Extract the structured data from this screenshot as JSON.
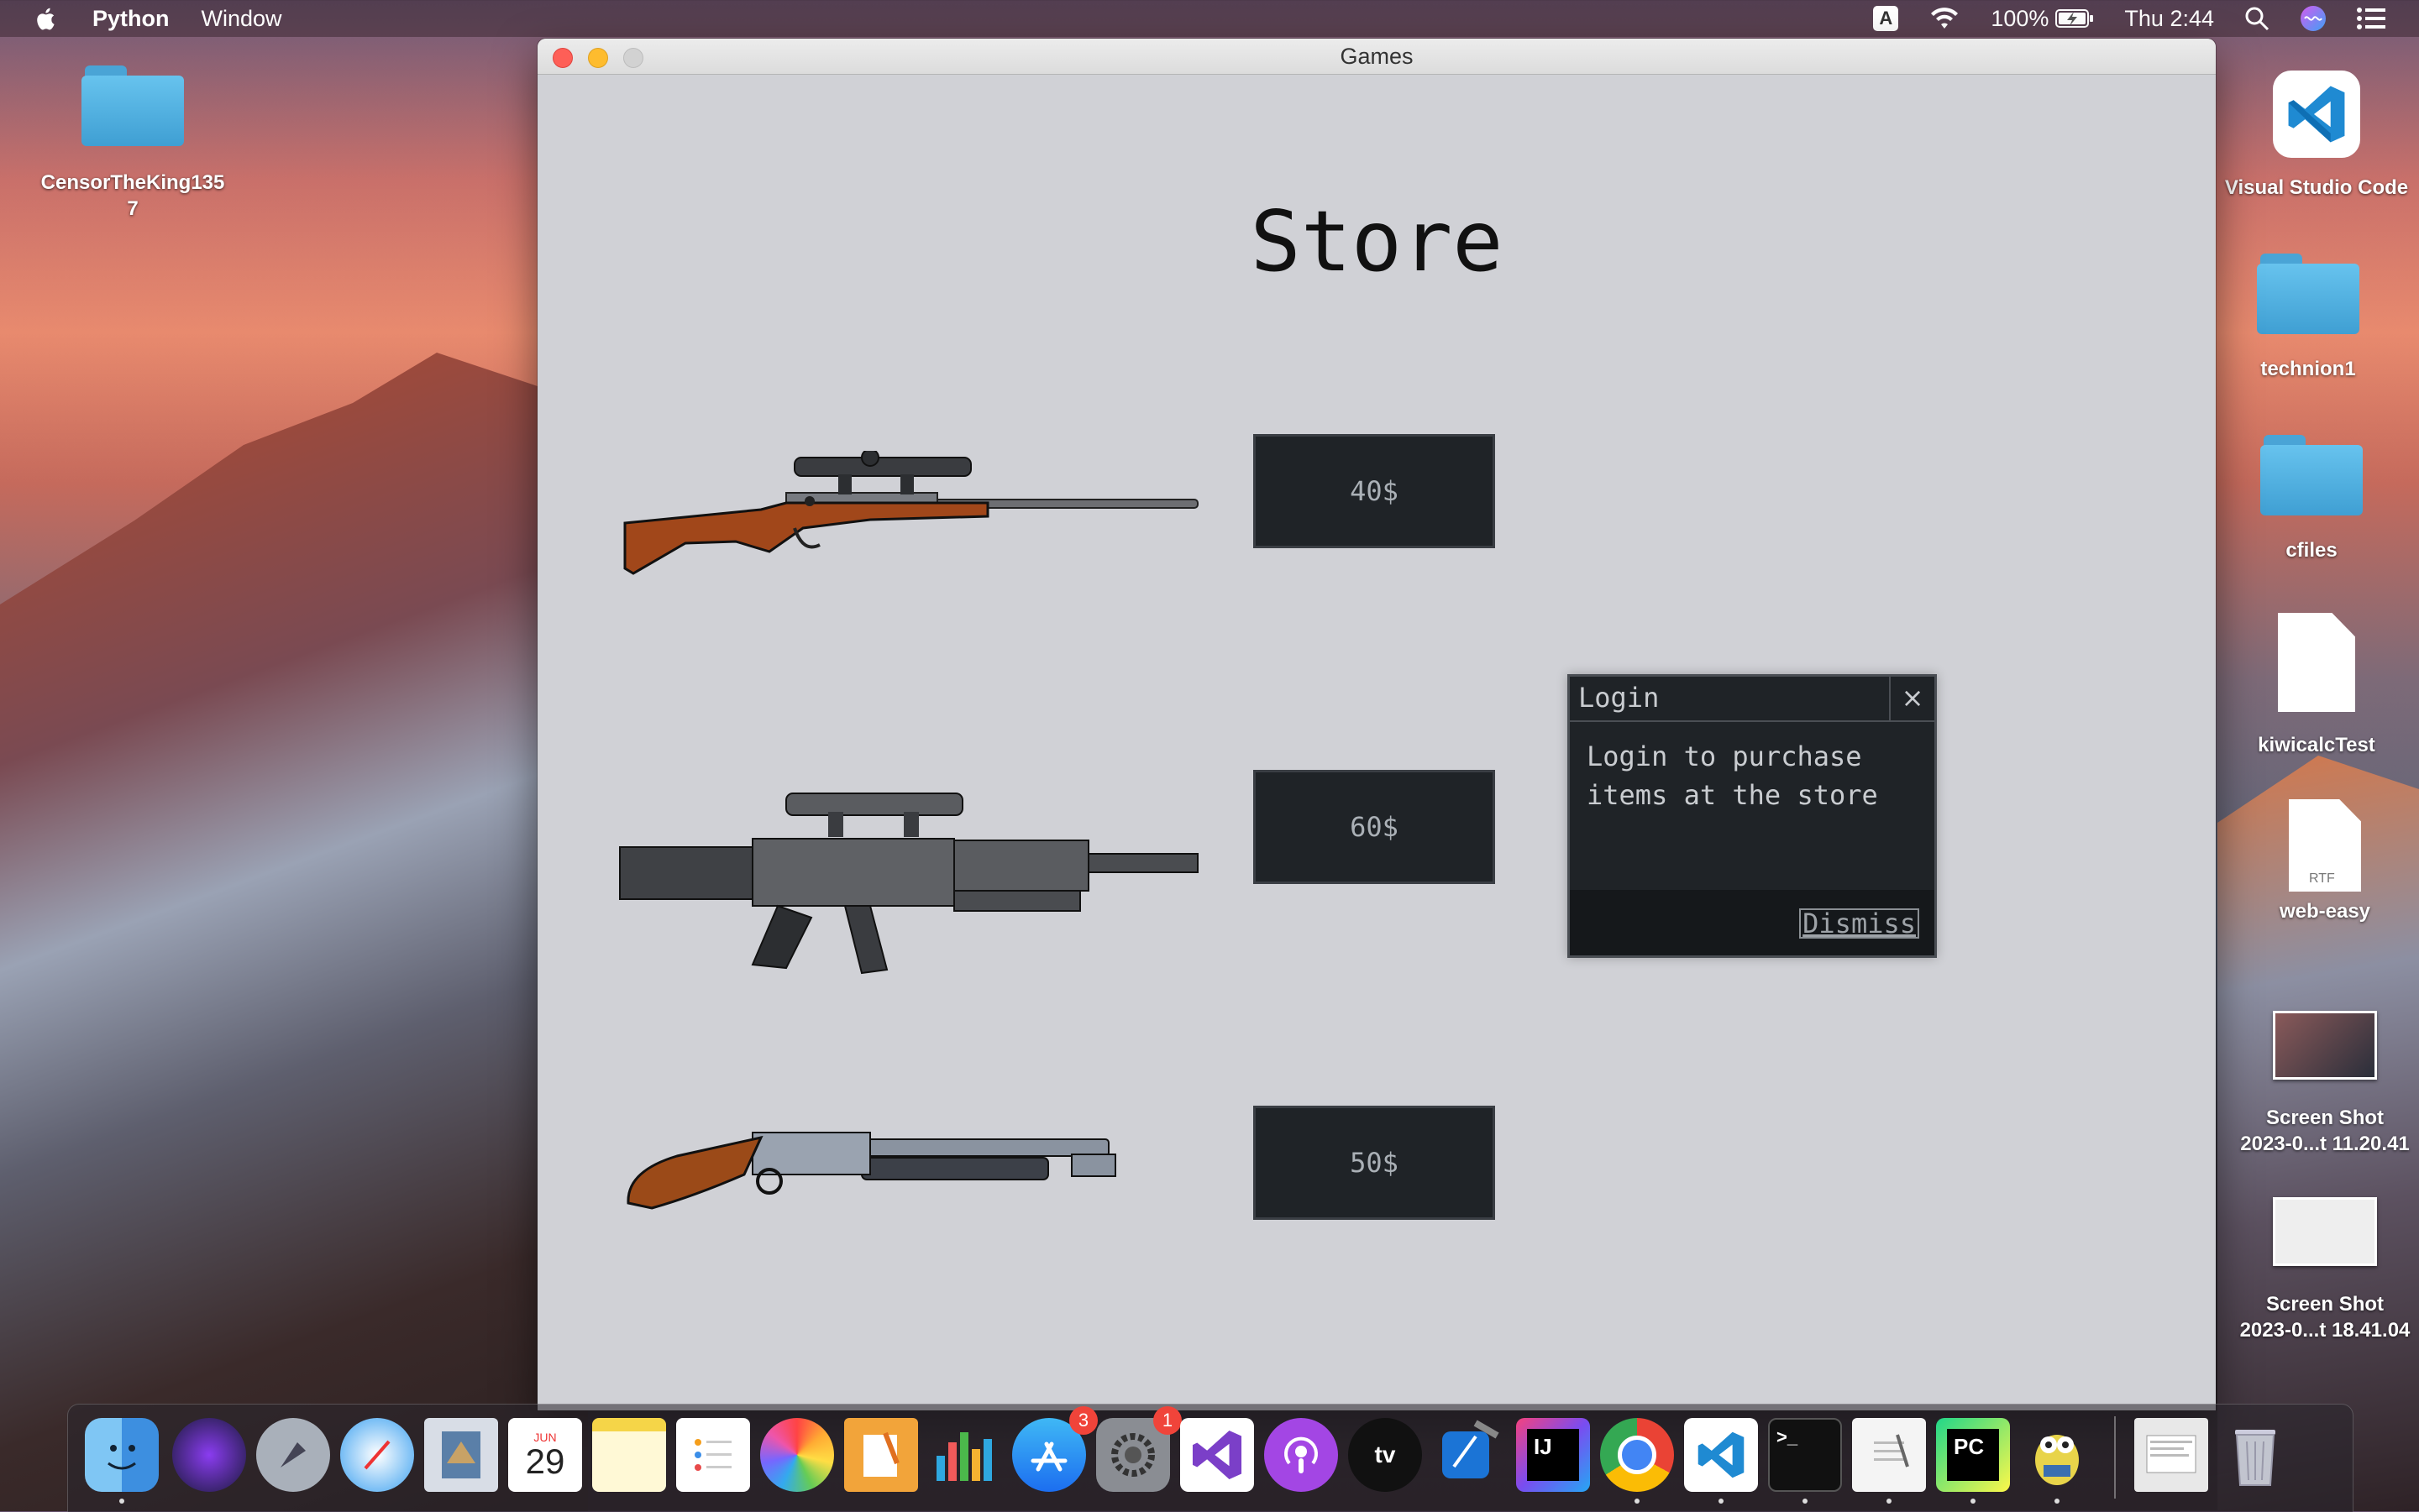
{
  "menubar": {
    "app_name": "Python",
    "menu_window": "Window",
    "battery": "100%",
    "clock": "Thu 2:44",
    "input_indicator": "A"
  },
  "desktop": {
    "left_icons": [
      {
        "label": "CensorTheKing135\n7",
        "icon": "folder-icon"
      }
    ],
    "right_icons": [
      {
        "label": "Visual Studio Code",
        "icon": "vscode-icon"
      },
      {
        "label": "technion1",
        "icon": "folder-icon"
      },
      {
        "label": "cfiles",
        "icon": "folder-icon"
      },
      {
        "label": "kiwicalcTest",
        "icon": "document-icon"
      },
      {
        "label": "web-easy",
        "icon": "rtf-document-icon",
        "badge": "RTF"
      },
      {
        "label": "Screen Shot\n2023-0...t 11.20.41",
        "icon": "screenshot-icon"
      },
      {
        "label": "Screen Shot\n2023-0...t 18.41.04",
        "icon": "screenshot-icon"
      }
    ]
  },
  "window": {
    "title": "Games",
    "heading": "Store",
    "items": [
      {
        "price": "40$",
        "icon": "hunting-rifle-icon"
      },
      {
        "price": "60$",
        "icon": "assault-rifle-icon"
      },
      {
        "price": "50$",
        "icon": "shotgun-icon"
      }
    ],
    "dialog": {
      "title": "Login",
      "close": "×",
      "message_line1": "Login to purchase",
      "message_line2": "items at the store",
      "dismiss": "Dismiss"
    }
  },
  "dock": {
    "calendar_month": "JUN",
    "calendar_day": "29",
    "app_store_badge": "3",
    "system_prefs_badge": "1",
    "intellij_label": "IJ",
    "pycharm_label": "PC",
    "terminal_prompt": ">_",
    "appletv_label": "tv"
  }
}
